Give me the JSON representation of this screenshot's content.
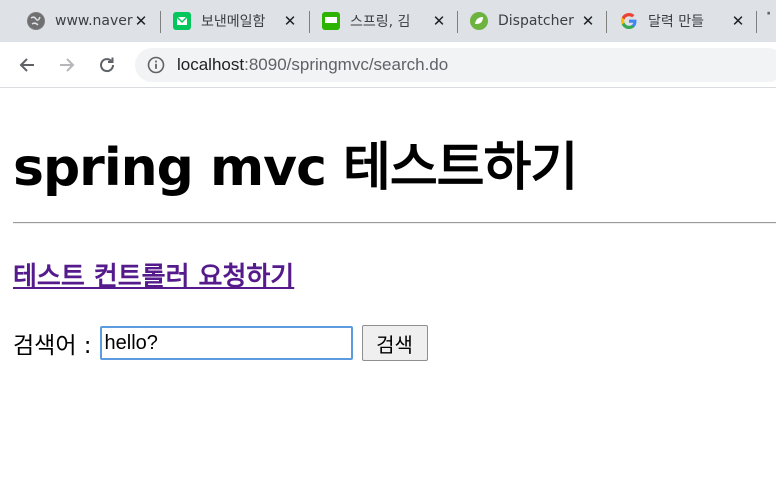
{
  "tabs": [
    {
      "title": "www.naver",
      "icon": "globe-icon",
      "close": "✕"
    },
    {
      "title": "보낸메일함",
      "icon": "mail-icon",
      "close": "✕"
    },
    {
      "title": "스프링, 김",
      "icon": "blog-icon",
      "close": "✕"
    },
    {
      "title": "Dispatcher",
      "icon": "spring-icon",
      "close": "✕"
    },
    {
      "title": "달력 만들",
      "icon": "google-icon",
      "close": "✕"
    }
  ],
  "toolbar": {
    "url_host": "localhost",
    "url_path": ":8090/springmvc/search.do"
  },
  "page": {
    "heading": "spring mvc 테스트하기",
    "test_link": "테스트 컨트롤러 요청하기",
    "search_label": "검색어 :",
    "search_value": "hello?",
    "search_button": "검색"
  },
  "colors": {
    "tabstrip_bg": "#dee1e6",
    "link_visited": "#551a8b",
    "input_focus": "#5b9be0"
  }
}
